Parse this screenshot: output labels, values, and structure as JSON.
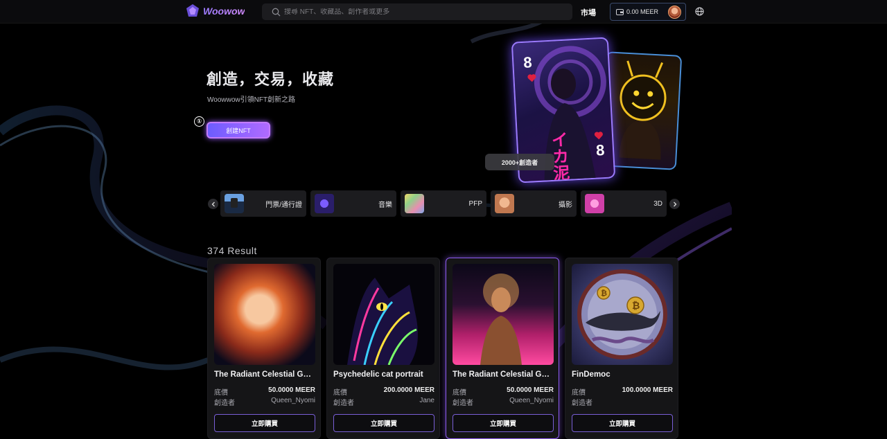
{
  "header": {
    "logo_text": "Woowow",
    "search_placeholder": "搜尋 NFT、收藏品、創作者或更多",
    "nav_market": "市場",
    "wallet_amount": "0.00 MEER"
  },
  "hero": {
    "title": "創造，交易，收藏",
    "subtitle": "Woowwow引領NFT創新之路",
    "marker": "①",
    "create_button": "創建NFT",
    "card_rank_top": "8",
    "card_rank_bottom": "8",
    "card_text": "イカ泥",
    "creators_badge": "2000+創造者"
  },
  "categories": [
    {
      "label": "門票/通行證",
      "icon": "pixel-avatar-thumb"
    },
    {
      "label": "音樂",
      "icon": "music-thumb"
    },
    {
      "label": "PFP",
      "icon": "pfp-thumb"
    },
    {
      "label": "攝影",
      "icon": "photo-thumb"
    },
    {
      "label": "3D",
      "icon": "3d-thumb"
    }
  ],
  "results": {
    "count_text": "374 Result",
    "price_label": "底價",
    "creator_label": "創造者",
    "buy_label": "立即購買",
    "items": [
      {
        "name": "The Radiant Celestial Goddess",
        "price": "50.0000 MEER",
        "creator": "Queen_Nyomi"
      },
      {
        "name": "Psychedelic cat portrait",
        "price": "200.0000 MEER",
        "creator": "Jane"
      },
      {
        "name": "The Radiant Celestial Goddess",
        "price": "50.0000 MEER",
        "creator": "Queen_Nyomi"
      },
      {
        "name": "FinDemoc",
        "price": "100.0000 MEER",
        "creator": ""
      }
    ]
  },
  "colors": {
    "accent": "#9b6bff",
    "background": "#000000",
    "card": "#151517"
  }
}
